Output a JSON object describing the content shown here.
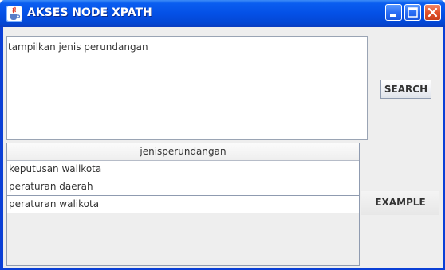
{
  "window": {
    "title": "AKSES NODE XPATH",
    "icons": {
      "app": "java-cup-icon",
      "minimize": "minimize-icon",
      "maximize": "maximize-icon",
      "close": "close-icon"
    },
    "colors": {
      "titlebar": "#0450e6",
      "close_button": "#e2522a",
      "content_bg": "#eeeeee"
    }
  },
  "query": {
    "value": "tampilkan jenis perundangan"
  },
  "buttons": {
    "search_label": "SEARCH",
    "example_label": "EXAMPLE"
  },
  "table": {
    "columns": [
      "jenisperundangan"
    ],
    "rows": [
      [
        "keputusan walikota"
      ],
      [
        "peraturan daerah"
      ],
      [
        "peraturan walikota"
      ]
    ]
  }
}
